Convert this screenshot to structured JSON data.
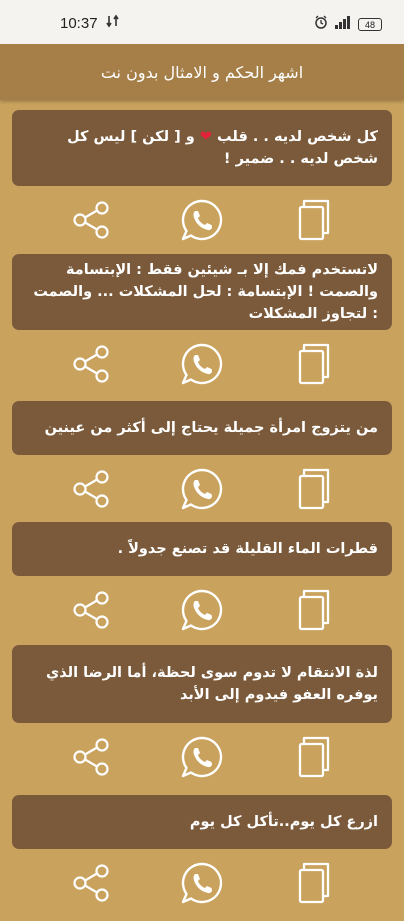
{
  "status_bar": {
    "time": "10:37",
    "battery": "48",
    "left_icon": "network-transfer-icon",
    "right_icons": [
      "alarm-icon",
      "signal-icon",
      "battery-icon"
    ]
  },
  "app_bar": {
    "title": "اشهر الحكم و الامثال بدون نت"
  },
  "colors": {
    "background": "#C9A25E",
    "appbar": "#A67F48",
    "card": "#7A5A3A",
    "icons": "#FFFFFF",
    "heart": "#E3223A"
  },
  "actions": {
    "share_icon": "share-icon",
    "whatsapp_icon": "whatsapp-icon",
    "copy_icon": "copy-icon"
  },
  "quotes": [
    {
      "text_before": "كل شخص لديه . . قلب",
      "heart": "❤",
      "text_after": " و [ لكن ] ليس كل شخص لديه . . ضمير !"
    },
    {
      "text": "لاتستخدم فمك إلا بـ شيئين فقط : الإبتسامة والصمت ! الإبتسامة : لحل المشكلات ... والصمت : لتجاوز المشكلات"
    },
    {
      "text": "من يتزوج امرأة جميلة يحتاج إلى أكثر من عينين"
    },
    {
      "text": "قطرات الماء القليلة قد تصنع جدولاً ."
    },
    {
      "text": "لذة الانتقام لا تدوم سوى لحظة، أما الرضا الذي يوفره العفو فيدوم إلى الأبد"
    },
    {
      "text": "ازرع كل يوم..تأكل كل يوم"
    }
  ]
}
